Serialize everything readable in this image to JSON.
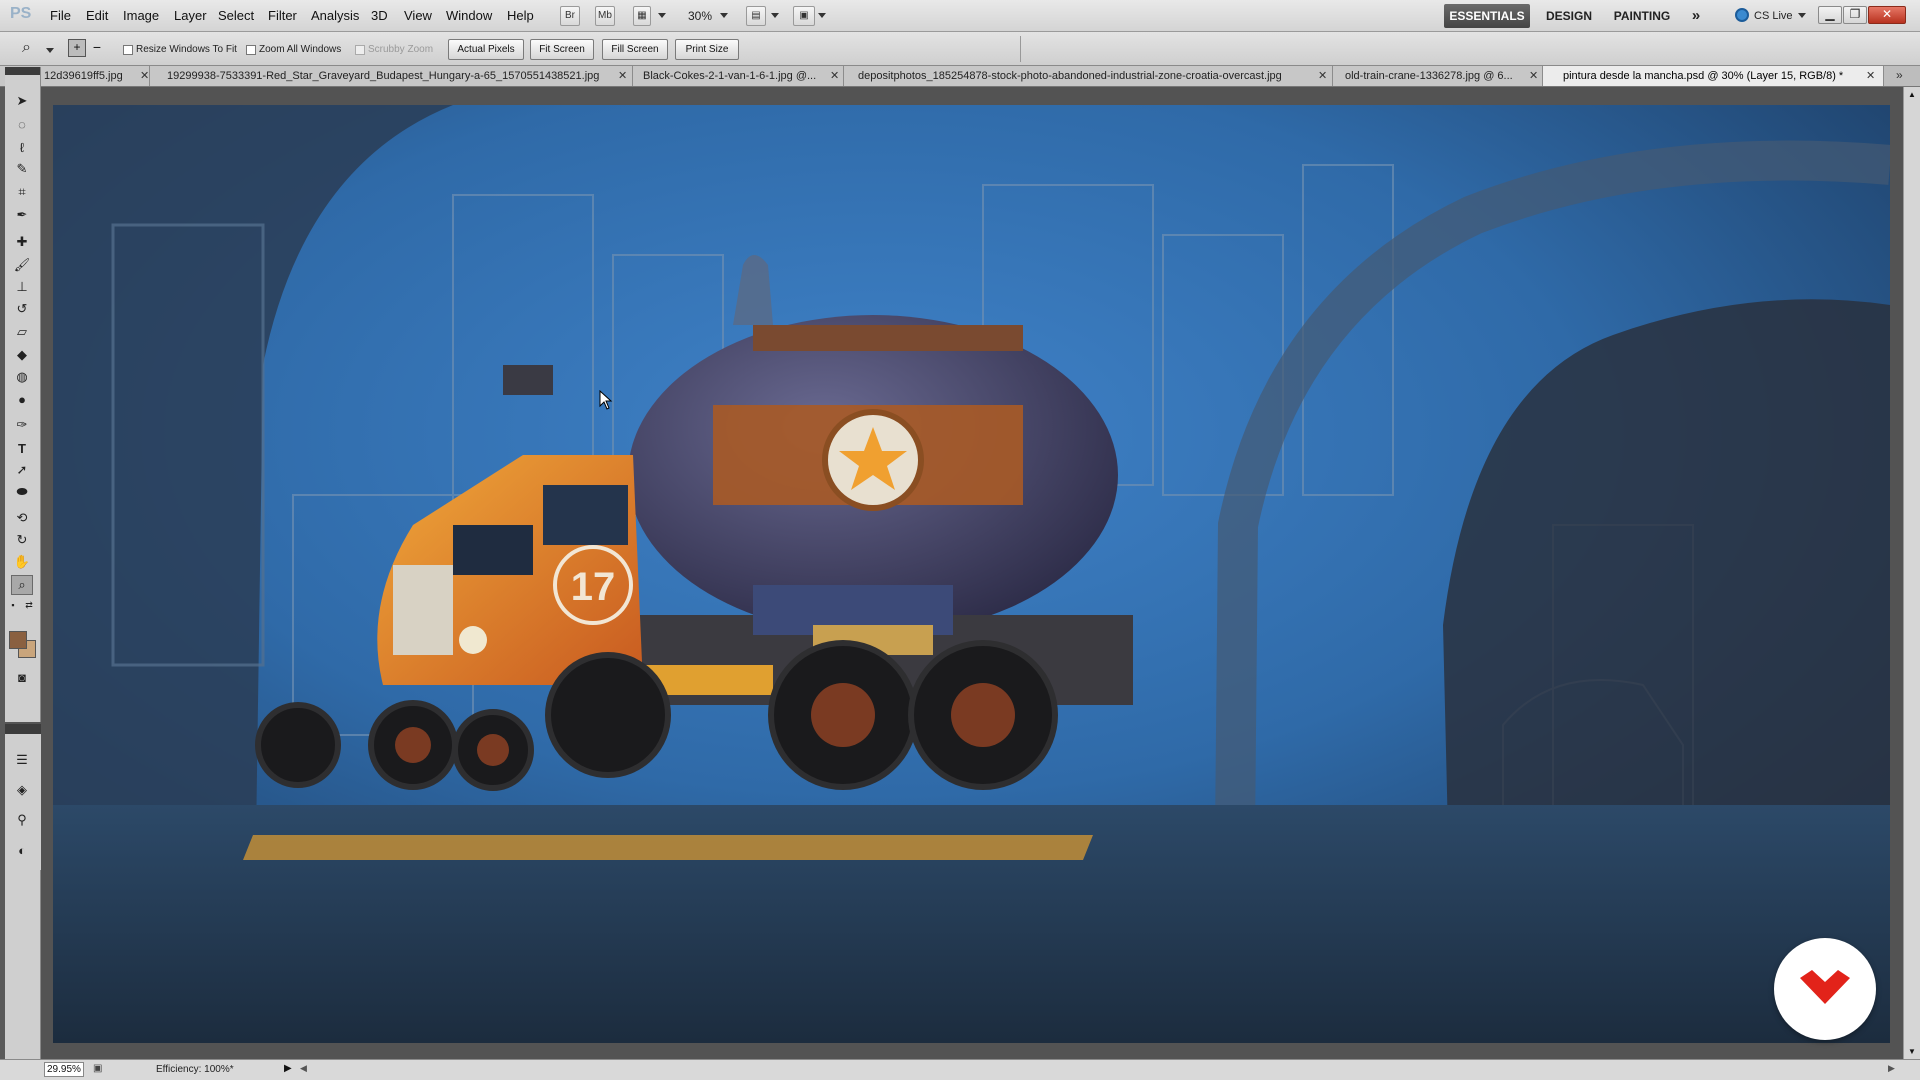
{
  "menubar": {
    "app_logo": "PS",
    "menus": [
      "File",
      "Edit",
      "Image",
      "Layer",
      "Select",
      "Filter",
      "Analysis",
      "3D",
      "View",
      "Window",
      "Help"
    ],
    "buttons": {
      "bridge": "Br",
      "mini_bridge": "Mb"
    },
    "zoom": "30%",
    "workspaces": [
      "ESSENTIALS",
      "DESIGN",
      "PAINTING"
    ],
    "more": "»",
    "cs_live": "CS Live"
  },
  "options": {
    "resize_windows": "Resize Windows To Fit",
    "zoom_all": "Zoom All Windows",
    "scrubby_zoom": "Scrubby Zoom",
    "actual_pixels": "Actual Pixels",
    "fit_screen": "Fit Screen",
    "fill_screen": "Fill Screen",
    "print_size": "Print Size"
  },
  "tabs": [
    {
      "label": "12d39619ff5.jpg"
    },
    {
      "label": "19299938-7533391-Red_Star_Graveyard_Budapest_Hungary-a-65_1570551438521.jpg"
    },
    {
      "label": "Black-Cokes-2-1-van-1-6-1.jpg @..."
    },
    {
      "label": "depositphotos_185254878-stock-photo-abandoned-industrial-zone-croatia-overcast.jpg"
    },
    {
      "label": "old-train-crane-1336278.jpg @ 6..."
    },
    {
      "label": "pintura desde la mancha.psd @ 30% (Layer 15, RGB/8) *"
    }
  ],
  "artwork": {
    "truck_number": "17"
  },
  "status": {
    "zoom": "29.95%",
    "efficiency": "Efficiency: 100%*"
  },
  "colors": {
    "foreground": "#8a6040",
    "background": "#c9a57c",
    "accent_badge": "#e2231a"
  }
}
